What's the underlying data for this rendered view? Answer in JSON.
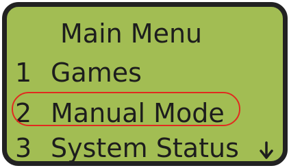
{
  "menu": {
    "title": "Main Menu",
    "items": [
      {
        "number": "1",
        "label": "Games"
      },
      {
        "number": "2",
        "label": "Manual Mode",
        "highlighted": true
      },
      {
        "number": "3",
        "label": "System Status"
      }
    ],
    "scroll_indicator_icon": "arrow-down-icon"
  },
  "colors": {
    "screen_background": "#a2bd53",
    "text": "#1d1d1d",
    "bezel": "#222222",
    "highlight_outline": "#e12a1f"
  }
}
